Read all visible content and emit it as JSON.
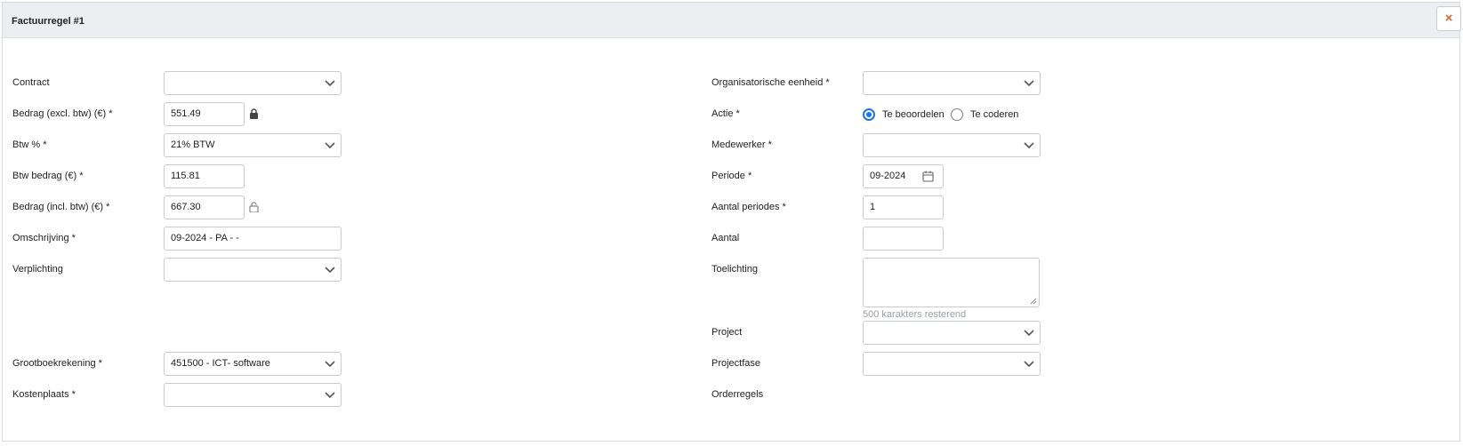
{
  "header": {
    "title": "Factuurregel #1",
    "close_label": "×"
  },
  "left": {
    "contract_label": "Contract",
    "contract_value": "",
    "bedrag_excl_label": "Bedrag (excl. btw) (€) *",
    "bedrag_excl_value": "551.49",
    "btw_pct_label": "Btw % *",
    "btw_pct_value": "21% BTW",
    "btw_bedrag_label": "Btw bedrag (€) *",
    "btw_bedrag_value": "115.81",
    "bedrag_incl_label": "Bedrag (incl. btw) (€) *",
    "bedrag_incl_value": "667.30",
    "omschrijving_label": "Omschrijving *",
    "omschrijving_value": "09-2024 - PA -  -",
    "verplichting_label": "Verplichting",
    "verplichting_value": "",
    "grootboek_label": "Grootboekrekening *",
    "grootboek_value": "451500 - ICT- software",
    "kostenplaats_label": "Kostenplaats *",
    "kostenplaats_value": ""
  },
  "right": {
    "org_label": "Organisatorische eenheid *",
    "org_value": "",
    "actie_label": "Actie *",
    "actie_options": [
      "Te beoordelen",
      "Te coderen"
    ],
    "actie_selected": "Te beoordelen",
    "medewerker_label": "Medewerker *",
    "medewerker_value": "",
    "periode_label": "Periode *",
    "periode_value": "09-2024",
    "aantal_periodes_label": "Aantal periodes *",
    "aantal_periodes_value": "1",
    "aantal_label": "Aantal",
    "aantal_value": "",
    "toelichting_label": "Toelichting",
    "toelichting_value": "",
    "toelichting_hint": "500 karakters resterend",
    "project_label": "Project",
    "project_value": "",
    "projectfase_label": "Projectfase",
    "projectfase_value": "",
    "orderregels_label": "Orderregels"
  },
  "icons": {
    "lock_closed": "lock-icon",
    "lock_open": "unlock-icon",
    "calendar": "calendar-icon",
    "chevron": "chevron-down-icon",
    "close": "close-icon"
  },
  "colors": {
    "accent": "#1a73e8",
    "close": "#e0672a",
    "header_bg": "#eceef1"
  }
}
